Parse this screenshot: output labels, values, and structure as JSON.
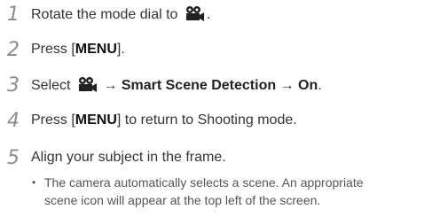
{
  "steps": [
    {
      "num": "1",
      "text": "Rotate the mode dial to",
      "icon": "movie-camera-icon",
      "tail": "."
    },
    {
      "num": "2",
      "pre": "Press [",
      "key": "MENU",
      "post": "]."
    },
    {
      "num": "3",
      "pre": "Select",
      "icon": "movie-camera-icon",
      "arrow1": "→",
      "item": "Smart Scene Detection",
      "arrow2": "→",
      "value": "On",
      "tail": "."
    },
    {
      "num": "4",
      "pre": "Press [",
      "key": "MENU",
      "post": "] to return to Shooting mode."
    },
    {
      "num": "5",
      "text": "Align your subject in the frame."
    }
  ],
  "note": {
    "bullet": "•",
    "line1": "The camera automatically selects a scene. An appropriate",
    "line2": "scene icon will appear at the top left of the screen."
  }
}
